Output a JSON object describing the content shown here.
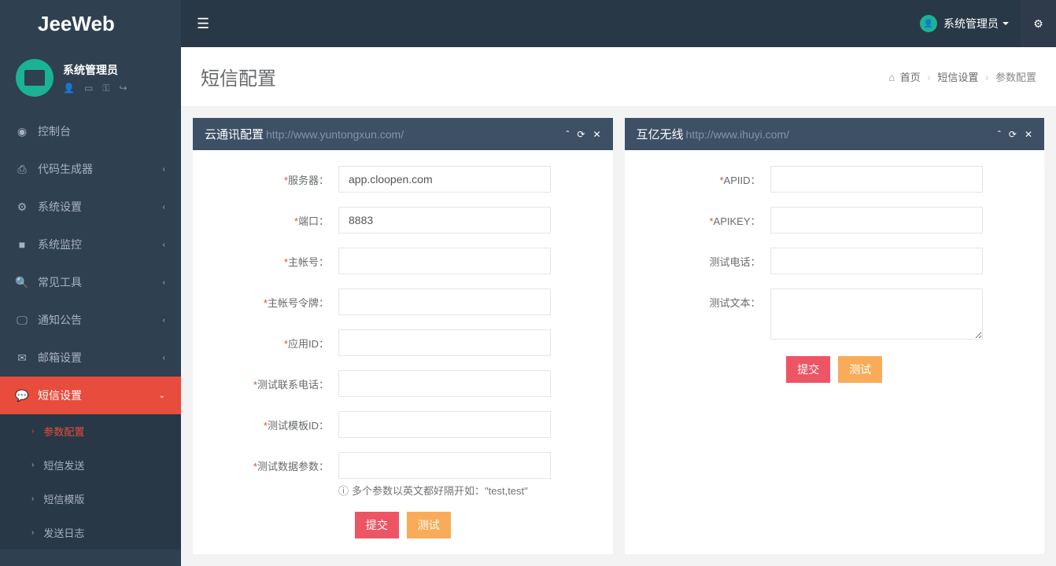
{
  "brand": "JeeWeb",
  "header": {
    "user_name": "系统管理员"
  },
  "profile": {
    "name": "系统管理员"
  },
  "nav": {
    "console": "控制台",
    "codegen": "代码生成器",
    "system_settings": "系统设置",
    "system_monitor": "系统监控",
    "common_tools": "常见工具",
    "notices": "通知公告",
    "mail_settings": "邮箱设置",
    "sms_settings": "短信设置",
    "sub": {
      "param_config": "参数配置",
      "sms_send": "短信发送",
      "sms_template": "短信模版",
      "send_log": "发送日志"
    }
  },
  "page": {
    "title": "短信配置",
    "breadcrumb": {
      "home": "首页",
      "sms": "短信设置",
      "param": "参数配置"
    }
  },
  "panel1": {
    "title": "云通讯配置",
    "subtitle": "http://www.yuntongxun.com/",
    "labels": {
      "server": "服务器：",
      "port": "端口：",
      "account": "主帐号：",
      "token": "主帐号令牌：",
      "appid": "应用ID：",
      "test_phone": "测试联系电话：",
      "test_template": "测试模板ID：",
      "test_params": "测试数据参数："
    },
    "values": {
      "server": "app.cloopen.com",
      "port": "8883",
      "account": "",
      "token": "",
      "appid": "",
      "test_phone": "",
      "test_template": "",
      "test_params": ""
    },
    "help": "多个参数以英文都好隔开如：\"test,test\"",
    "submit": "提交",
    "test": "测试"
  },
  "panel2": {
    "title": "互亿无线",
    "subtitle": "http://www.ihuyi.com/",
    "labels": {
      "apiid": "APIID：",
      "apikey": "APIKEY：",
      "test_phone": "测试电话：",
      "test_text": "测试文本："
    },
    "values": {
      "apiid": "",
      "apikey": "",
      "test_phone": "",
      "test_text": ""
    },
    "submit": "提交",
    "test": "测试"
  }
}
